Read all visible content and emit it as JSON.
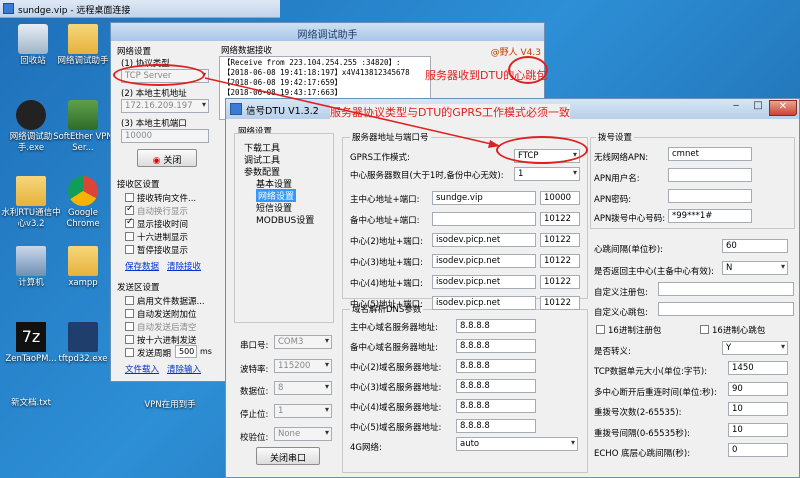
{
  "rdp": {
    "title": "sundge.vip - 远程桌面连接"
  },
  "desktop": {
    "icons": [
      "回收站",
      "网络调试助手",
      "网络调试助手.exe",
      "SoftEther VPN Ser...",
      "水利RTU通信中心v3.2",
      "Google Chrome",
      "计算机",
      "xampp",
      "ZenTaoPM...",
      "tftpd32.exe",
      "新文档.txt",
      "VPN在用到手"
    ]
  },
  "net": {
    "title": "网络调试助手",
    "brand": "@野人 V4.3",
    "settings_title": "网络设置",
    "protocol_label": "(1) 协议类型",
    "protocol_value": "TCP Server",
    "host_label": "(2) 本地主机地址",
    "host_value": "172.16.209.197",
    "port_label": "(3) 本地主机端口",
    "port_value": "10000",
    "close_btn": "关闭",
    "recv_settings_title": "接收区设置",
    "recv_opts": [
      "接收转向文件...",
      "自动换行显示",
      "显示接收时间",
      "十六进制显示",
      "暂停接收显示"
    ],
    "save_data": "保存数据",
    "clear_display": "清除接收",
    "send_settings_title": "发送区设置",
    "send_opts": [
      "启用文件数据源...",
      "自动发送附加位",
      "自动发送后清空",
      "按十六进制发送"
    ],
    "send_period_label": "发送周期",
    "send_period_value": "500",
    "send_period_unit": "ms",
    "file_load": "文件载入",
    "clear_input": "清除输入",
    "recv_title": "网络数据接收",
    "recv_lines": [
      "【Receive from 223.104.254.255 :34820】:",
      "【2018-06-08 19:41:18:197】x4V413812345678",
      "【2018-06-08 19:42:17:659】",
      "【2018-06-08 19:43:17:663】"
    ]
  },
  "annotations": {
    "heartbeat": "服务器收到DTU的心跳包",
    "mode_note": "服务器协议类型与DTU的GPRS工作模式必须一致"
  },
  "dtu": {
    "title": "信号DTU V1.3.2",
    "net_settings_title": "网络设置",
    "tree": [
      "下载工具",
      "调试工具",
      "参数配置",
      "基本设置",
      "网络设置",
      "短信设置",
      "MODBUS设置"
    ],
    "serial": {
      "port_label": "串口号:",
      "port_value": "COM3",
      "baud_label": "波特率:",
      "baud_value": "115200",
      "databits_label": "数据位:",
      "databits_value": "8",
      "stopbits_label": "停止位:",
      "stopbits_value": "1",
      "parity_label": "校验位:",
      "parity_value": "None",
      "close_serial": "关闭串口"
    },
    "server": {
      "group_title": "服务器地址与端口号",
      "mode_label": "GPRS工作模式:",
      "mode_value": "FTCP",
      "count_label": "中心服务器数目(大于1时,备份中心无效):",
      "count_value": "1",
      "rows": [
        {
          "label": "主中心地址+端口:",
          "addr": "sundge.vip",
          "port": "10000"
        },
        {
          "label": "备中心地址+端口:",
          "addr": "",
          "port": "10122"
        },
        {
          "label": "中心(2)地址+端口:",
          "addr": "isodev.picp.net",
          "port": "10122"
        },
        {
          "label": "中心(3)地址+端口:",
          "addr": "isodev.picp.net",
          "port": "10122"
        },
        {
          "label": "中心(4)地址+端口:",
          "addr": "isodev.picp.net",
          "port": "10122"
        },
        {
          "label": "中心(5)地址+端口:",
          "addr": "isodev.picp.net",
          "port": "10122"
        }
      ]
    },
    "dns": {
      "group_title": "域名解析DNS参数",
      "rows": [
        {
          "label": "主中心域名服务器地址:",
          "value": "8.8.8.8"
        },
        {
          "label": "备中心域名服务器地址:",
          "value": "8.8.8.8"
        },
        {
          "label": "中心(2)域名服务器地址:",
          "value": "8.8.8.8"
        },
        {
          "label": "中心(3)域名服务器地址:",
          "value": "8.8.8.8"
        },
        {
          "label": "中心(4)域名服务器地址:",
          "value": "8.8.8.8"
        },
        {
          "label": "中心(5)域名服务器地址:",
          "value": "8.8.8.8"
        }
      ],
      "net4g_label": "4G网络:",
      "net4g_value": "auto"
    },
    "dial": {
      "group_title": "拨号设置",
      "apn_label": "无线网络APN:",
      "apn_value": "cmnet",
      "user_label": "APN用户名:",
      "user_value": "",
      "pwd_label": "APN密码:",
      "pwd_value": "",
      "num_label": "APN拨号中心号码:",
      "num_value": "*99***1#"
    },
    "misc": {
      "heartbeat_label": "心跳间隔(单位秒):",
      "heartbeat_value": "60",
      "return_label": "是否返回主中心(主备中心有效):",
      "return_value": "N",
      "reg_label": "自定义注册包:",
      "reg_value": "",
      "hb_label": "自定义心跳包:",
      "hb_value": "",
      "hex_reg": "16进制注册包",
      "hex_hb": "16进制心跳包",
      "escape_label": "是否转义:",
      "escape_value": "Y",
      "tcp_size_label": "TCP数据单元大小(单位:字节):",
      "tcp_size_value": "1450",
      "reconnect_label": "多中心断开后重连时间(单位:秒):",
      "reconnect_value": "90",
      "redial_count_label": "重拨号次数(2-65535):",
      "redial_count_value": "10",
      "redial_interval_label": "重拨号间隔(0-65535秒):",
      "redial_interval_value": "10",
      "echo_label": "ECHO 底层心跳间隔(秒):",
      "echo_value": "0"
    }
  }
}
